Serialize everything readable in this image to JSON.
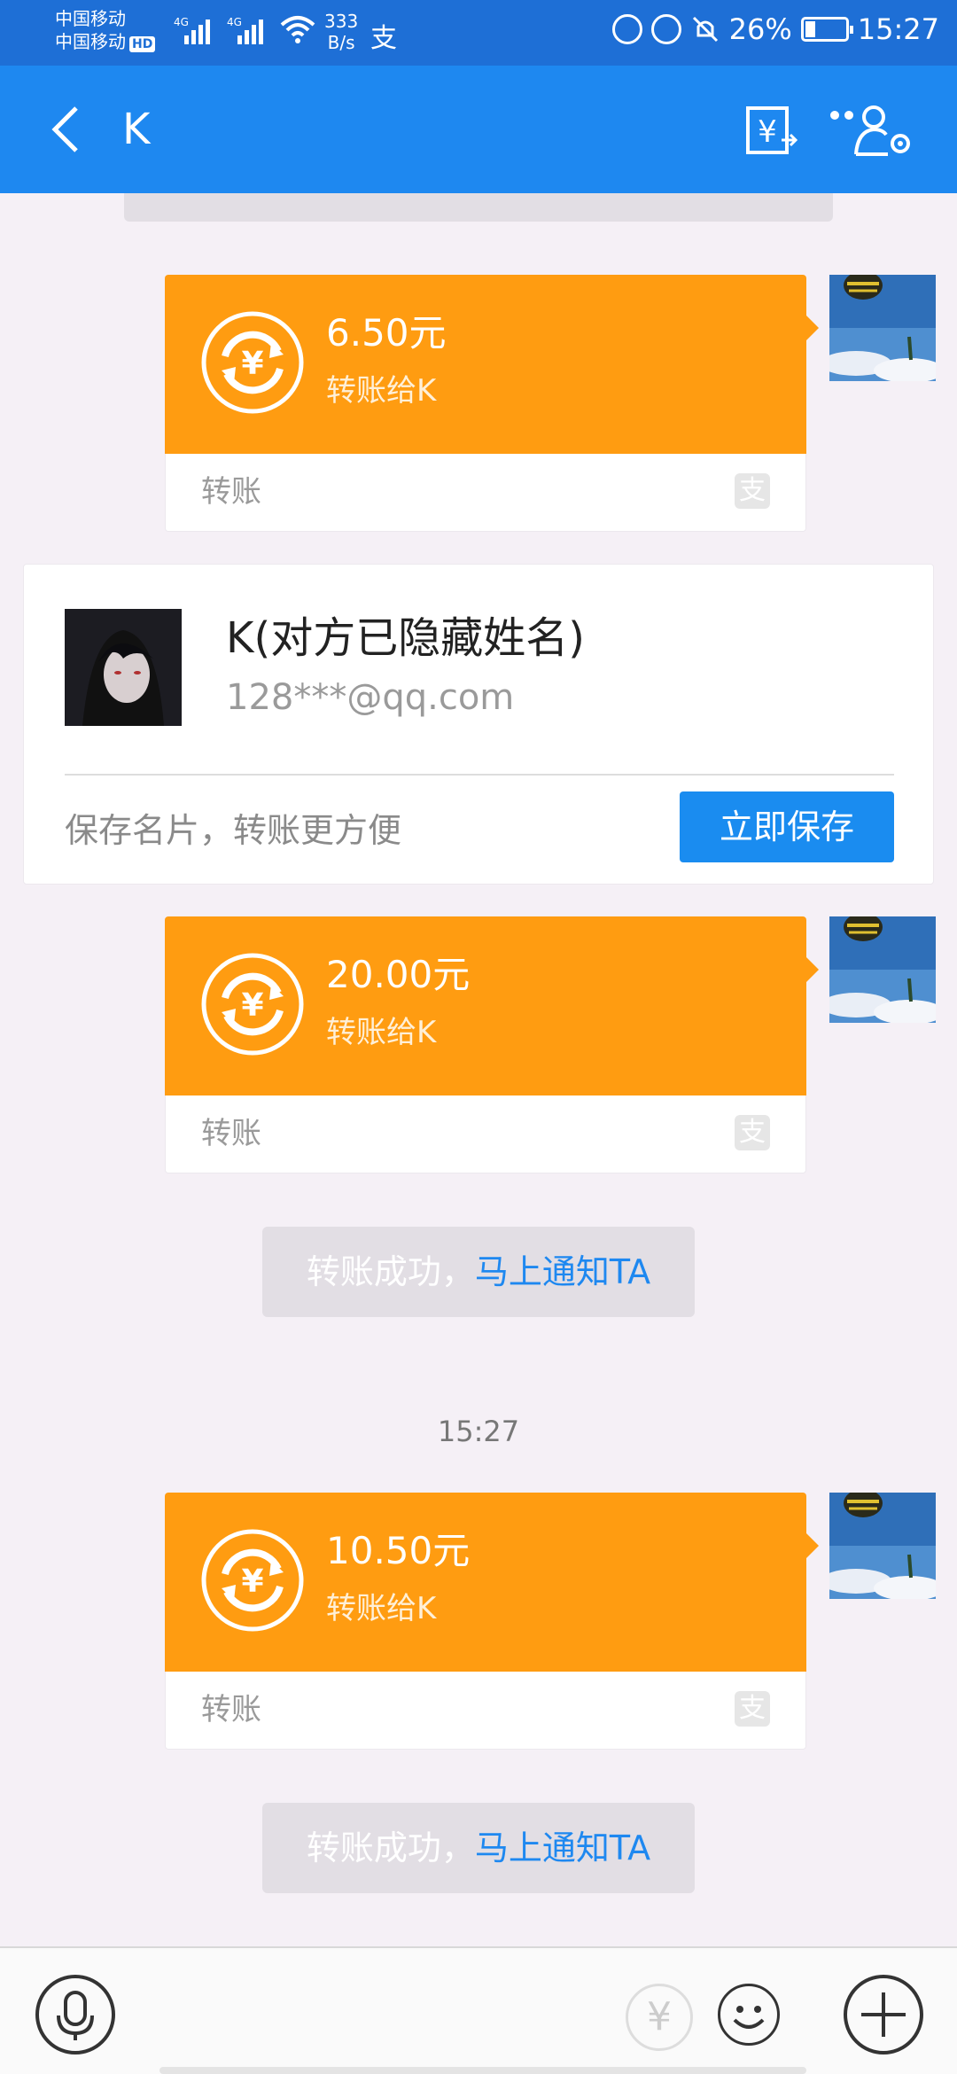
{
  "status_bar": {
    "carrier_1": "中国移动",
    "carrier_2": "中国移动",
    "hd_badge": "HD",
    "network_1": "4G",
    "network_2": "4G",
    "speed_value": "333",
    "speed_unit": "B/s",
    "alipay_glyph": "支",
    "battery_percent": "26%",
    "battery_level": 0.26,
    "time": "15:27"
  },
  "header": {
    "title": "K",
    "icons": [
      "back-icon",
      "transfer-records-icon",
      "chat-settings-icon"
    ]
  },
  "messages": {
    "transfer_1": {
      "amount": "6.50元",
      "to": "转账给K",
      "label": "转账"
    },
    "contact_card": {
      "name": "K(对方已隐藏姓名)",
      "email": "128***@qq.com",
      "tip": "保存名片，转账更方便",
      "save_button": "立即保存"
    },
    "transfer_2": {
      "amount": "20.00元",
      "to": "转账给K",
      "label": "转账"
    },
    "notice_1": {
      "text": "转账成功，",
      "link": "马上通知TA"
    },
    "timestamp": "15:27",
    "transfer_3": {
      "amount": "10.50元",
      "to": "转账给K",
      "label": "转账"
    },
    "notice_2": {
      "text": "转账成功，",
      "link": "马上通知TA"
    }
  },
  "bottom_bar": {
    "yen_glyph": "¥",
    "icons": [
      "microphone-icon",
      "transfer-icon",
      "emoji-icon",
      "plus-icon"
    ]
  },
  "colors": {
    "header_blue": "#1e88f0",
    "transfer_orange": "#ff9c11",
    "link_blue": "#1e88f0",
    "button_blue": "#1a8cf0"
  }
}
